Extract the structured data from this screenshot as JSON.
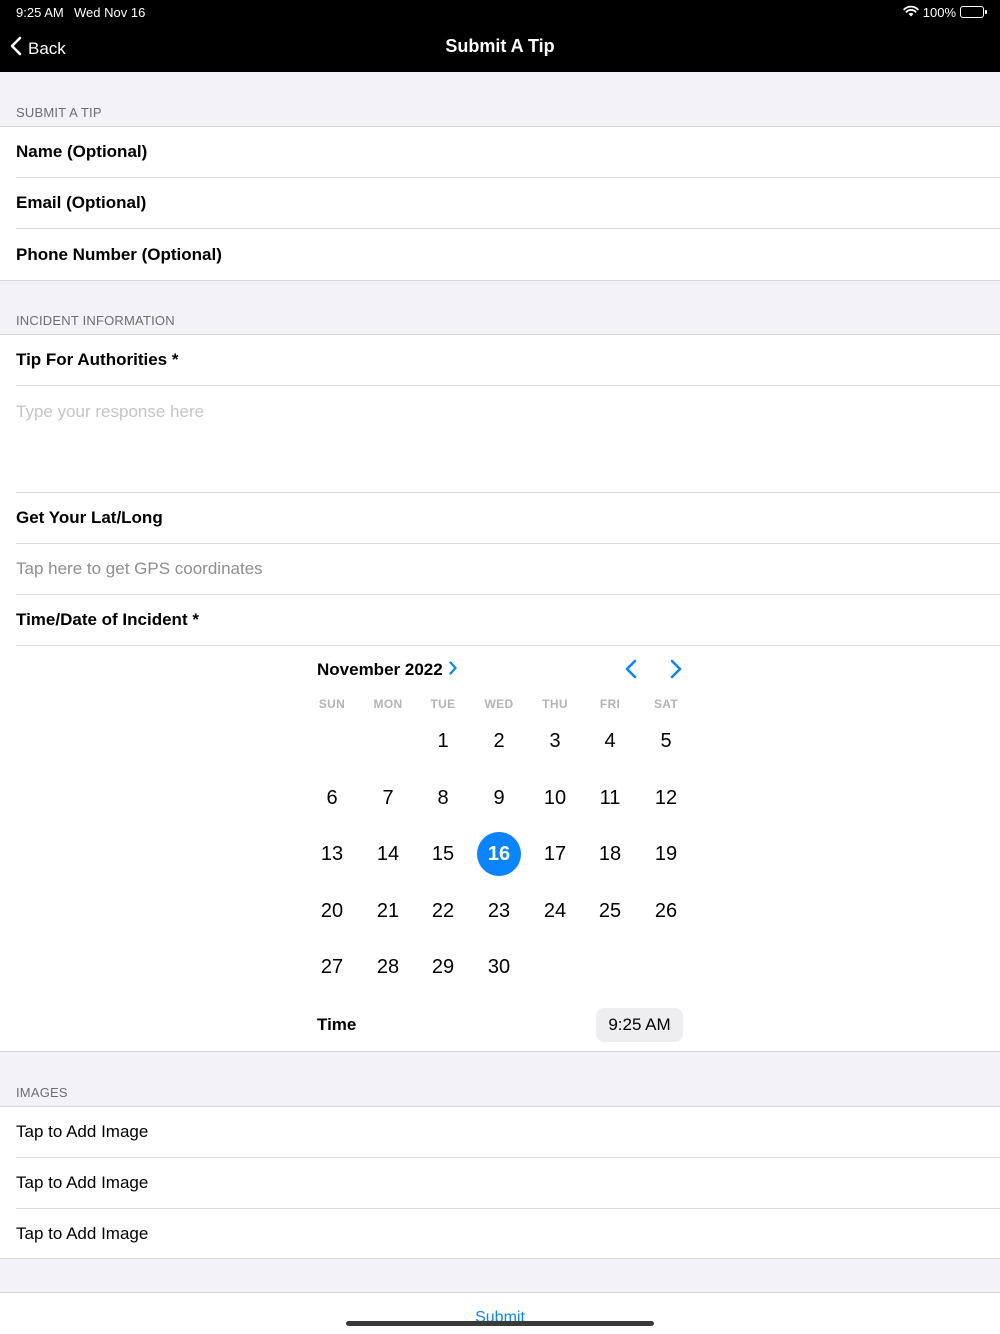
{
  "status": {
    "time": "9:25 AM",
    "date": "Wed Nov 16",
    "battery": "100%"
  },
  "nav": {
    "back_label": "Back",
    "title": "Submit A Tip"
  },
  "sections": {
    "submit": {
      "label": "SUBMIT A TIP",
      "fields": [
        "Name (Optional)",
        "Email (Optional)",
        "Phone Number (Optional)"
      ]
    },
    "incident": {
      "label": "INCIDENT INFORMATION",
      "tip_label": "Tip For Authorities *",
      "tip_placeholder": "Type your response here",
      "latlong_label": "Get Your Lat/Long",
      "gps_hint": "Tap here to get GPS coordinates",
      "datetime_label": "Time/Date of Incident *"
    },
    "images": {
      "label": "IMAGES",
      "items": [
        "Tap to Add Image",
        "Tap to Add Image",
        "Tap to Add Image"
      ]
    }
  },
  "calendar": {
    "month": "November 2022",
    "weekdays": [
      "SUN",
      "MON",
      "TUE",
      "WED",
      "THU",
      "FRI",
      "SAT"
    ],
    "first_weekday_index": 2,
    "days_in_month": 30,
    "selected_day": 16,
    "time_label": "Time",
    "time_value": "9:25 AM"
  },
  "submit_label": "Submit",
  "colors": {
    "accent": "#0a84ff",
    "header_bg": "#000000",
    "group_bg": "#f2f2f7"
  }
}
